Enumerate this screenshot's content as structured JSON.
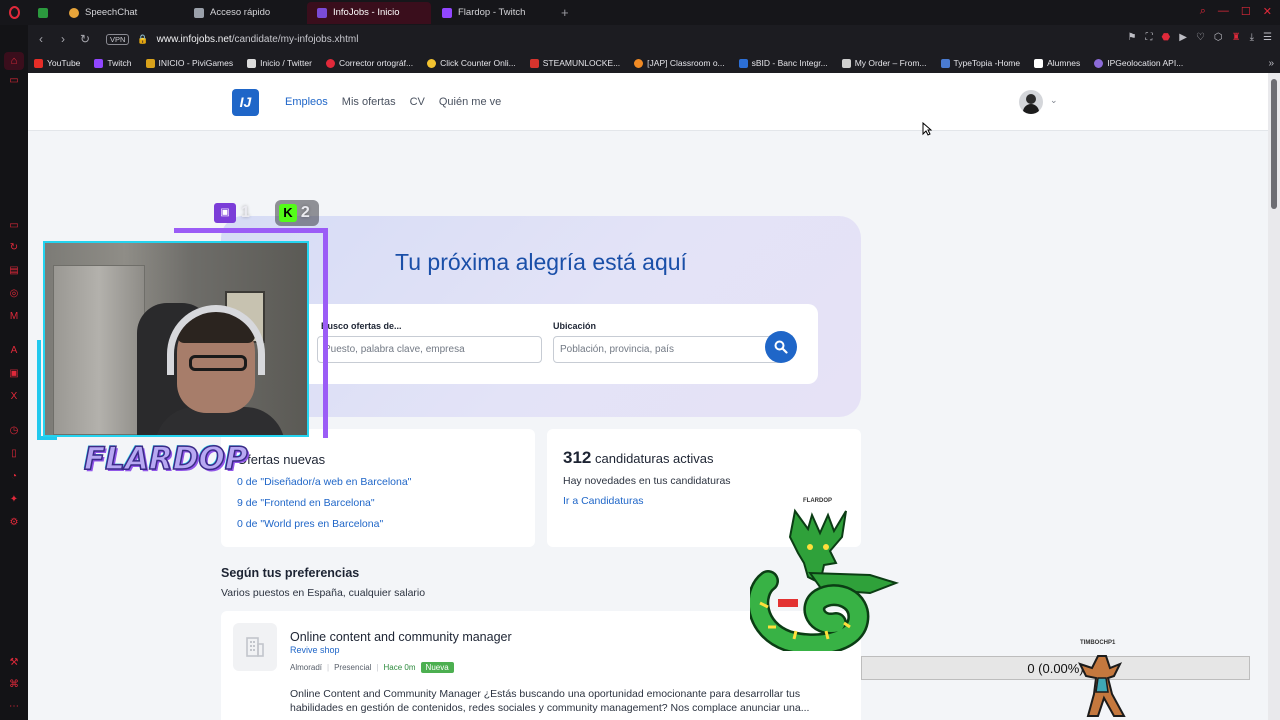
{
  "browser": {
    "tabs": [
      {
        "label": "",
        "color": "#2b9a3e"
      },
      {
        "label": "SpeechChat",
        "color": "#e7a43a"
      },
      {
        "label": "Acceso rápido",
        "color": "#9aa0aa"
      },
      {
        "label": "InfoJobs - Inicio",
        "color": "#7a4bd6"
      },
      {
        "label": "Flardop - Twitch",
        "color": "#9146ff"
      }
    ],
    "vpn_label": "VPN",
    "url_host": "www.infojobs.net",
    "url_path": "/candidate/my-infojobs.xhtml",
    "bookmarks": [
      {
        "label": "YouTube",
        "color": "#e52d27"
      },
      {
        "label": "Twitch",
        "color": "#9146ff"
      },
      {
        "label": "INICIO - PiviGames",
        "color": "#d9a21b"
      },
      {
        "label": "Inicio / Twitter",
        "color": "#dddddd"
      },
      {
        "label": "Corrector ortográf...",
        "color": "#e0293a"
      },
      {
        "label": "Click Counter Onli...",
        "color": "#f2c230"
      },
      {
        "label": "STEAMUNLOCKE...",
        "color": "#d6342d"
      },
      {
        "label": "[JAP] Classroom o...",
        "color": "#f08a24"
      },
      {
        "label": "sBID - Banc Integr...",
        "color": "#2c6fd6"
      },
      {
        "label": "My Order – From...",
        "color": "#cfcfcf"
      },
      {
        "label": "TypeTopia -Home",
        "color": "#4a7bd1"
      },
      {
        "label": "Alumnes",
        "color": "#ffffff"
      },
      {
        "label": "IPGeolocation API...",
        "color": "#8c6bd8"
      }
    ]
  },
  "header": {
    "logo": "IJ",
    "nav": [
      "Empleos",
      "Mis ofertas",
      "CV",
      "Quién me ve"
    ]
  },
  "hero": {
    "title": "Tu próxima alegría está aquí",
    "what_label": "Busco ofertas de...",
    "what_placeholder": "Puesto, palabra clave, empresa",
    "where_label": "Ubicación",
    "where_placeholder": "Población, provincia, país"
  },
  "offers_card": {
    "title": "Ofertas nuevas",
    "links": [
      "0 de \"Diseñador/a web en Barcelona\"",
      "9 de \"Frontend en Barcelona\"",
      "0 de \"World pres en Barcelona\""
    ]
  },
  "applications_card": {
    "count": "312",
    "title": "candidaturas activas",
    "subtitle": "Hay novedades en tus candidaturas",
    "link": "Ir a Candidaturas"
  },
  "preferences": {
    "title": "Según tus preferencias",
    "subtitle": "Varios puestos en España, cualquier salario"
  },
  "job": {
    "title": "Online content and community manager",
    "company": "Revive shop",
    "location": "Almoradí",
    "modality": "Presencial",
    "posted": "Hace 0m",
    "badge": "Nueva",
    "description": "Online Content and Community Manager ¿Estás buscando una oportunidad emocionante para desarrollar tus habilidades en gestión de contenidos, redes sociales y community management? Nos complace anunciar una..."
  },
  "overlay": {
    "twitch_count": "1",
    "kick_count": "2",
    "kick_letter": "K",
    "streamer_name": "FLARDOP",
    "pokemon_label": "FLARDOP",
    "progress_text": "0 (0.00%)",
    "progress_fraction": 0.0,
    "progress_owner": "TIMBOCHP1"
  }
}
